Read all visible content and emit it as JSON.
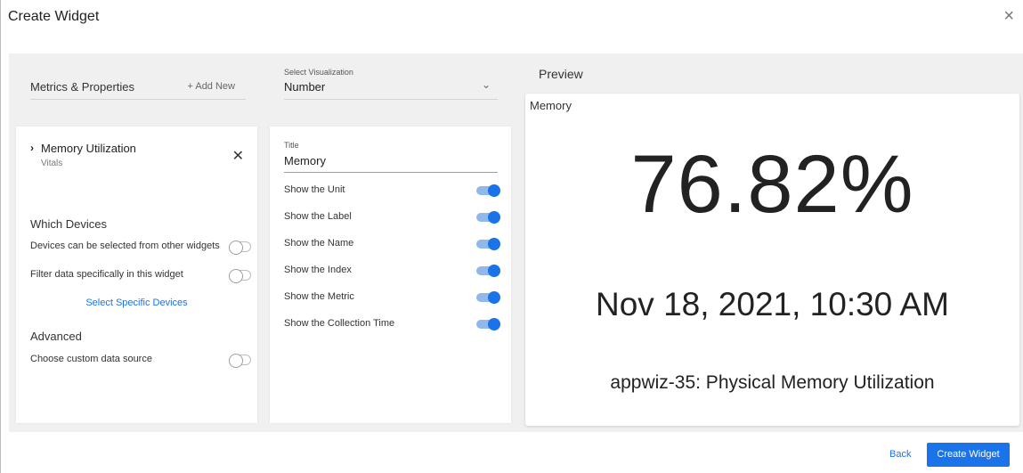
{
  "dialog": {
    "title": "Create Widget",
    "close_icon": "close-icon"
  },
  "metrics": {
    "header_label": "Metrics & Properties",
    "add_new_label": "+ Add New",
    "items": [
      {
        "name": "Memory Utilization",
        "category": "Vitals",
        "expand_icon": "chevron-right-icon",
        "remove_icon": "close-icon"
      }
    ]
  },
  "devices": {
    "heading": "Which Devices",
    "options": [
      {
        "label": "Devices can be selected from other widgets",
        "enabled": false
      },
      {
        "label": "Filter data specifically in this widget",
        "enabled": false
      }
    ],
    "select_link": "Select Specific Devices"
  },
  "advanced": {
    "heading": "Advanced",
    "options": [
      {
        "label": "Choose custom data source",
        "enabled": false
      }
    ]
  },
  "visualization": {
    "label": "Select Visualization",
    "value": "Number",
    "dropdown_icon": "chevron-down-icon"
  },
  "settings": {
    "title_label": "Title",
    "title_value": "Memory",
    "options": [
      {
        "label": "Show the Unit",
        "enabled": true
      },
      {
        "label": "Show the Label",
        "enabled": true
      },
      {
        "label": "Show the Name",
        "enabled": true
      },
      {
        "label": "Show the Index",
        "enabled": true
      },
      {
        "label": "Show the Metric",
        "enabled": true
      },
      {
        "label": "Show the Collection Time",
        "enabled": true
      }
    ]
  },
  "preview": {
    "heading": "Preview",
    "widget_title": "Memory",
    "value": "76.82%",
    "collection_time": "Nov 18, 2021, 10:30 AM",
    "metric_name": "appwiz-35: Physical Memory Utilization"
  },
  "footer": {
    "back_label": "Back",
    "create_label": "Create Widget"
  },
  "colors": {
    "accent": "#1a73e8",
    "workspace_bg": "#f0f0f0",
    "toggle_track_on": "#90b8ea"
  }
}
